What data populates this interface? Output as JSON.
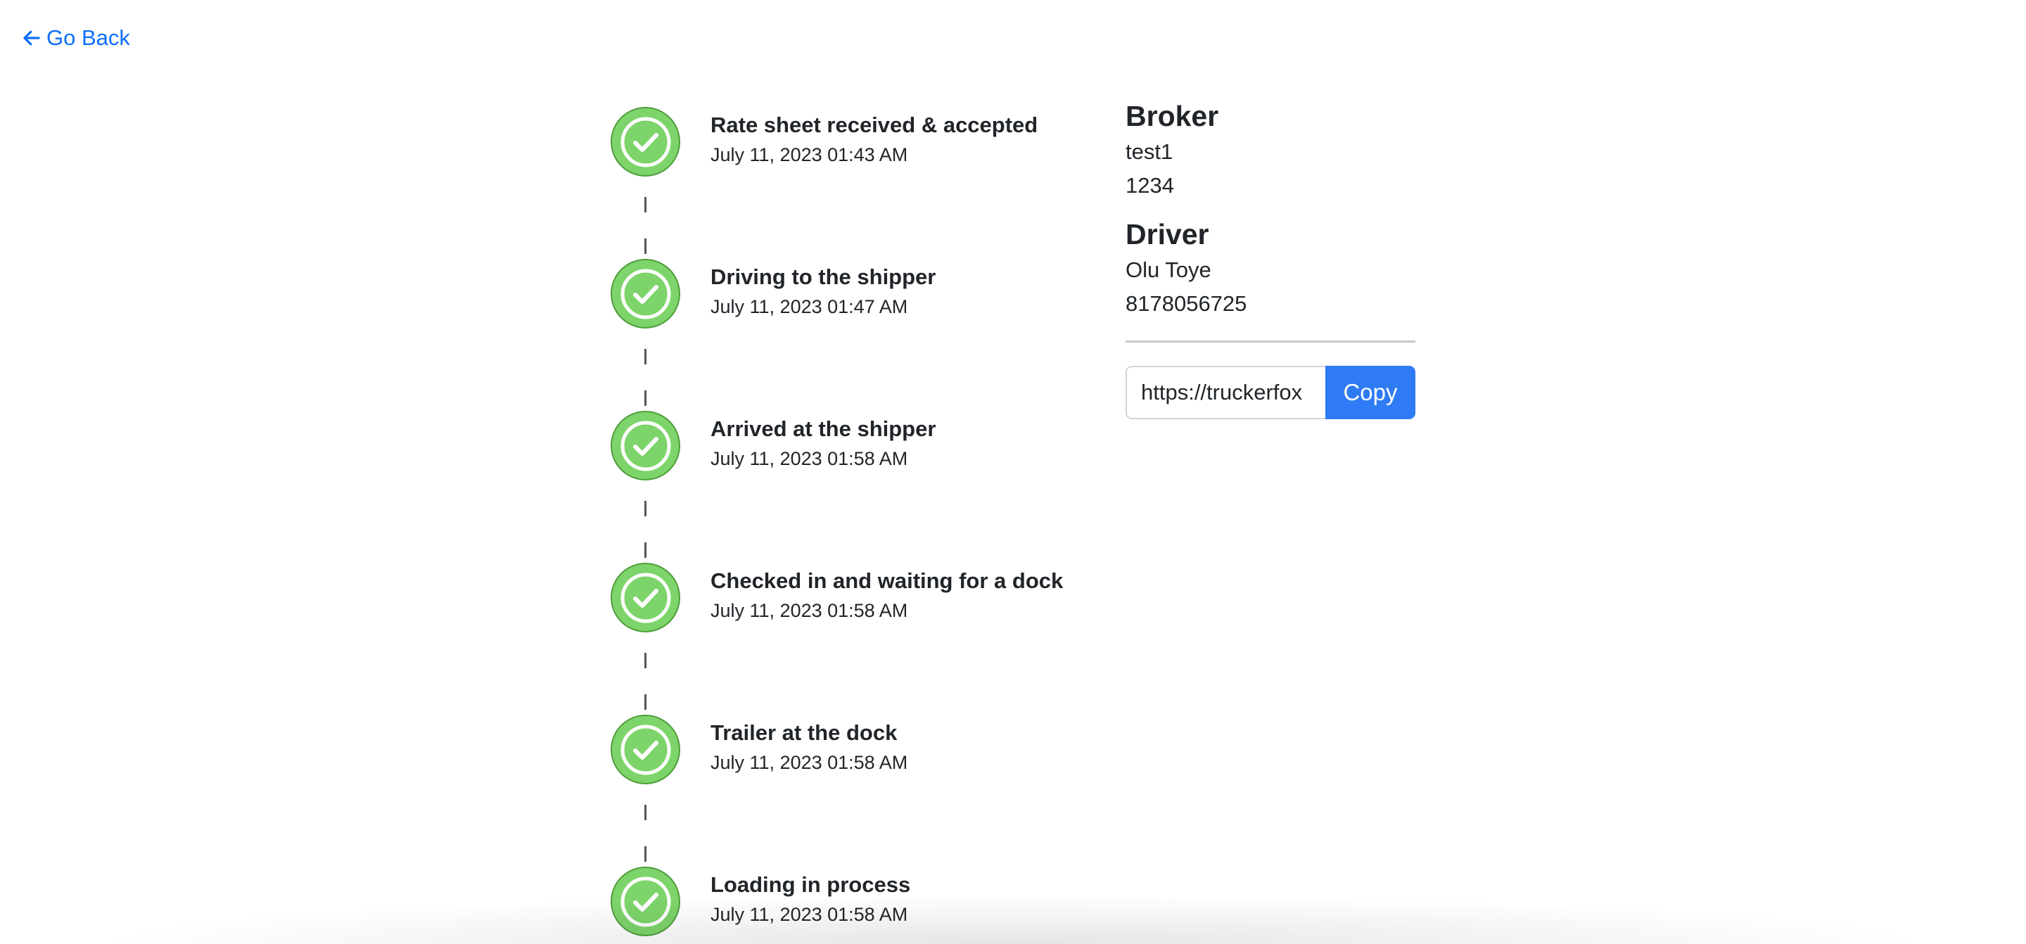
{
  "nav": {
    "back_label": "Go Back"
  },
  "timeline": [
    {
      "title": "Rate sheet received & accepted",
      "time": "July 11, 2023 01:43 AM",
      "status": "completed"
    },
    {
      "title": "Driving to the shipper",
      "time": "July 11, 2023 01:47 AM",
      "status": "completed"
    },
    {
      "title": "Arrived at the shipper",
      "time": "July 11, 2023 01:58 AM",
      "status": "completed"
    },
    {
      "title": "Checked in and waiting for a dock",
      "time": "July 11, 2023 01:58 AM",
      "status": "completed"
    },
    {
      "title": "Trailer at the dock",
      "time": "July 11, 2023 01:58 AM",
      "status": "completed"
    },
    {
      "title": "Loading in process",
      "time": "July 11, 2023 01:58 AM",
      "status": "completed"
    }
  ],
  "broker": {
    "heading": "Broker",
    "name": "test1",
    "number": "1234"
  },
  "driver": {
    "heading": "Driver",
    "name": "Olu Toye",
    "phone": "8178056725"
  },
  "share": {
    "url_value": "https://truckerfox",
    "copy_label": "Copy"
  },
  "colors": {
    "accent": "#0d6efd",
    "button": "#2f7bf5",
    "status_complete": "#7dd46a"
  },
  "icons": {
    "back": "arrow-left-icon",
    "step": "check-circle-icon"
  }
}
